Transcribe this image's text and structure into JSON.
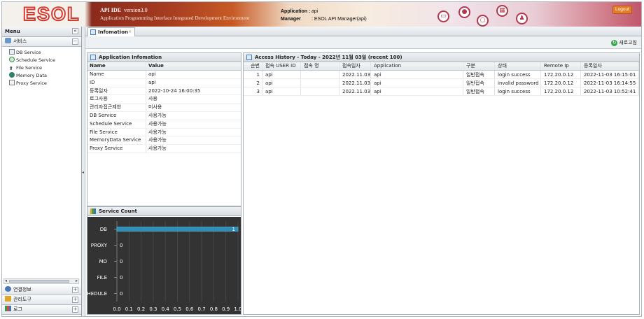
{
  "header": {
    "logo": "ESOL",
    "ide_name": "API IDE",
    "ide_version": "version3.0",
    "ide_subtitle": "Application Programming Interface Integrated Development Environment",
    "application_label": "Application :",
    "application_value": "api",
    "manager_label": "Manager",
    "manager_value": ": ESOL API Manager(api)",
    "logout_label": "Logout",
    "icons": [
      "chat-icon",
      "user-lock-icon",
      "search-icon",
      "calendar-icon",
      "manager-icon"
    ]
  },
  "menu": {
    "title": "Menu",
    "collapse_glyph": "«",
    "sections": {
      "service": {
        "label": "서비스",
        "toggle": "−"
      },
      "connection": {
        "label": "연결정보",
        "toggle": "+"
      },
      "tools": {
        "label": "관리도구",
        "toggle": "+"
      },
      "log": {
        "label": "로그",
        "toggle": "+"
      }
    },
    "service_items": [
      {
        "label": "DB Service",
        "icon": "database-icon"
      },
      {
        "label": "Schedule Service",
        "icon": "schedule-icon"
      },
      {
        "label": "File Service",
        "icon": "file-icon"
      },
      {
        "label": "Memory Data",
        "icon": "memory-icon"
      },
      {
        "label": "Proxy Service",
        "icon": "proxy-icon"
      }
    ]
  },
  "tab": {
    "label": "Infomation",
    "close": "×"
  },
  "toolbar": {
    "refresh_label": "새로고침"
  },
  "app_info": {
    "title": "Application Infomation",
    "columns": [
      "Name",
      "Value"
    ],
    "rows": [
      [
        "Name",
        "api"
      ],
      [
        "ID",
        "api"
      ],
      [
        "등록일자",
        "2022-10-24 16:00:35"
      ],
      [
        "로그사용",
        "사용"
      ],
      [
        "관리자접근제한",
        "미사용"
      ],
      [
        "DB Service",
        "사용가능"
      ],
      [
        "Schedule Service",
        "사용가능"
      ],
      [
        "File Service",
        "사용가능"
      ],
      [
        "MemoryData Service",
        "사용가능"
      ],
      [
        "Proxy Service",
        "사용가능"
      ]
    ]
  },
  "service_count": {
    "title": "Service Count"
  },
  "chart_data": {
    "type": "bar",
    "orientation": "horizontal",
    "categories": [
      "DB",
      "PROXY",
      "MD",
      "FILE",
      "SCHEDULE"
    ],
    "values": [
      1,
      0,
      0,
      0,
      0
    ],
    "data_labels": [
      "1",
      "0",
      "0",
      "0",
      "0"
    ],
    "xlim": [
      0,
      1.0
    ],
    "xticks": [
      "0.0",
      "0.1",
      "0.2",
      "0.3",
      "0.4",
      "0.5",
      "0.6",
      "0.7",
      "0.8",
      "0.9",
      "1.0"
    ],
    "grid": true,
    "colors": {
      "background": "#333333",
      "bar": "#2e8fb8",
      "text": "#ffffff"
    }
  },
  "access_history": {
    "title": "Access History - Today - 2022년 11월 03일 (recent 100)",
    "columns": [
      "순번",
      "접속 USER ID",
      "접속 명",
      "접속일자",
      "Application",
      "구분",
      "상태",
      "Remote Ip",
      "등록일자"
    ],
    "rows": [
      [
        "1",
        "api",
        "",
        "2022.11.03",
        "api",
        "일반접속",
        "login success",
        "172.20.0.12",
        "2022-11-03 16:15:01"
      ],
      [
        "2",
        "api",
        "",
        "2022.11.03",
        "api",
        "일반접속",
        "invalid password",
        "172.20.0.12",
        "2022-11-03 16:14:55"
      ],
      [
        "3",
        "api",
        "",
        "2022.11.03",
        "api",
        "일반접속",
        "login success",
        "172.20.0.12",
        "2022-11-03 10:52:41"
      ]
    ]
  }
}
